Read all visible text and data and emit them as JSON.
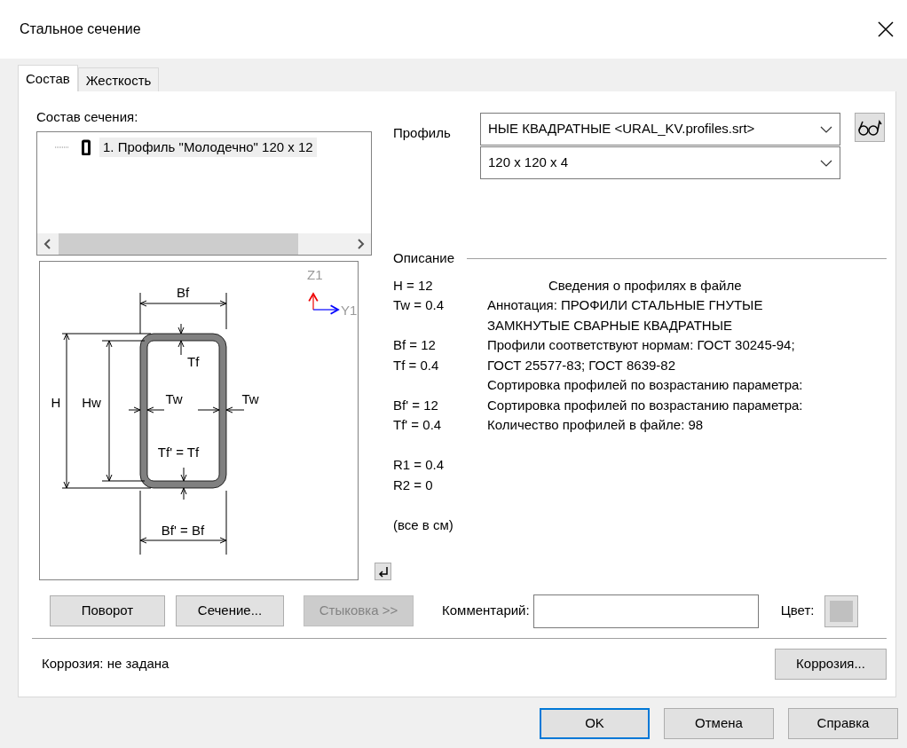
{
  "window": {
    "title": "Стальное сечение"
  },
  "tabs": [
    {
      "label": "Состав",
      "selected": true
    },
    {
      "label": "Жесткость",
      "selected": false
    }
  ],
  "composition": {
    "label": "Состав сечения:",
    "items": [
      {
        "label": "1. Профиль \"Молодечно\" 120 x 12",
        "selected": true
      }
    ]
  },
  "diagram": {
    "labels": [
      "Bf",
      "H",
      "Hw",
      "Tf",
      "Tw",
      "Tw",
      "Tf' = Tf",
      "Bf' = Bf"
    ],
    "axes": [
      "Z1",
      "Y1"
    ]
  },
  "profile": {
    "label": "Профиль",
    "type_value": "НЫЕ КВАДРАТНЫЕ <URAL_KV.profiles.srt>",
    "size_value": "120 x 120 x 4"
  },
  "description": {
    "title": "Описание",
    "params": [
      [
        "H = 12",
        "Tw = 0.4"
      ],
      [
        "Bf = 12",
        "Tf = 0.4"
      ],
      [
        "Bf' = 12",
        "Tf' = 0.4"
      ],
      [
        "R1 = 0.4",
        "R2 = 0"
      ]
    ],
    "units": "(все в см)",
    "info_title": "Сведения о профилях в файле",
    "info_lines": [
      "Аннотация: ПРОФИЛИ СТАЛЬНЫЕ ГНУТЫЕ",
      "ЗАМКНУТЫЕ СВАРНЫЕ КВАДРАТНЫЕ",
      "Профили соответствуют нормам: ГОСТ 30245-94;",
      "ГОСТ 25577-83; ГОСТ 8639-82",
      "Сортировка профилей по возрастанию параметра:",
      "Сортировка профилей по возрастанию параметра:",
      "Количество профилей в файле: 98"
    ]
  },
  "buttons": [
    {
      "label": "Поворот",
      "disabled": false
    },
    {
      "label": "Сечение...",
      "disabled": false
    },
    {
      "label": "Стыковка >>",
      "disabled": true
    }
  ],
  "comment": {
    "label": "Комментарий:"
  },
  "color": {
    "label": "Цвет:",
    "color": "#c0c0c0"
  },
  "corrosion": {
    "status": "Коррозия: не задана",
    "button": "Коррозия..."
  },
  "footer_buttons": [
    {
      "label": "OK",
      "default": true
    },
    {
      "label": "Отмена",
      "default": false
    },
    {
      "label": "Справка",
      "default": false
    }
  ]
}
